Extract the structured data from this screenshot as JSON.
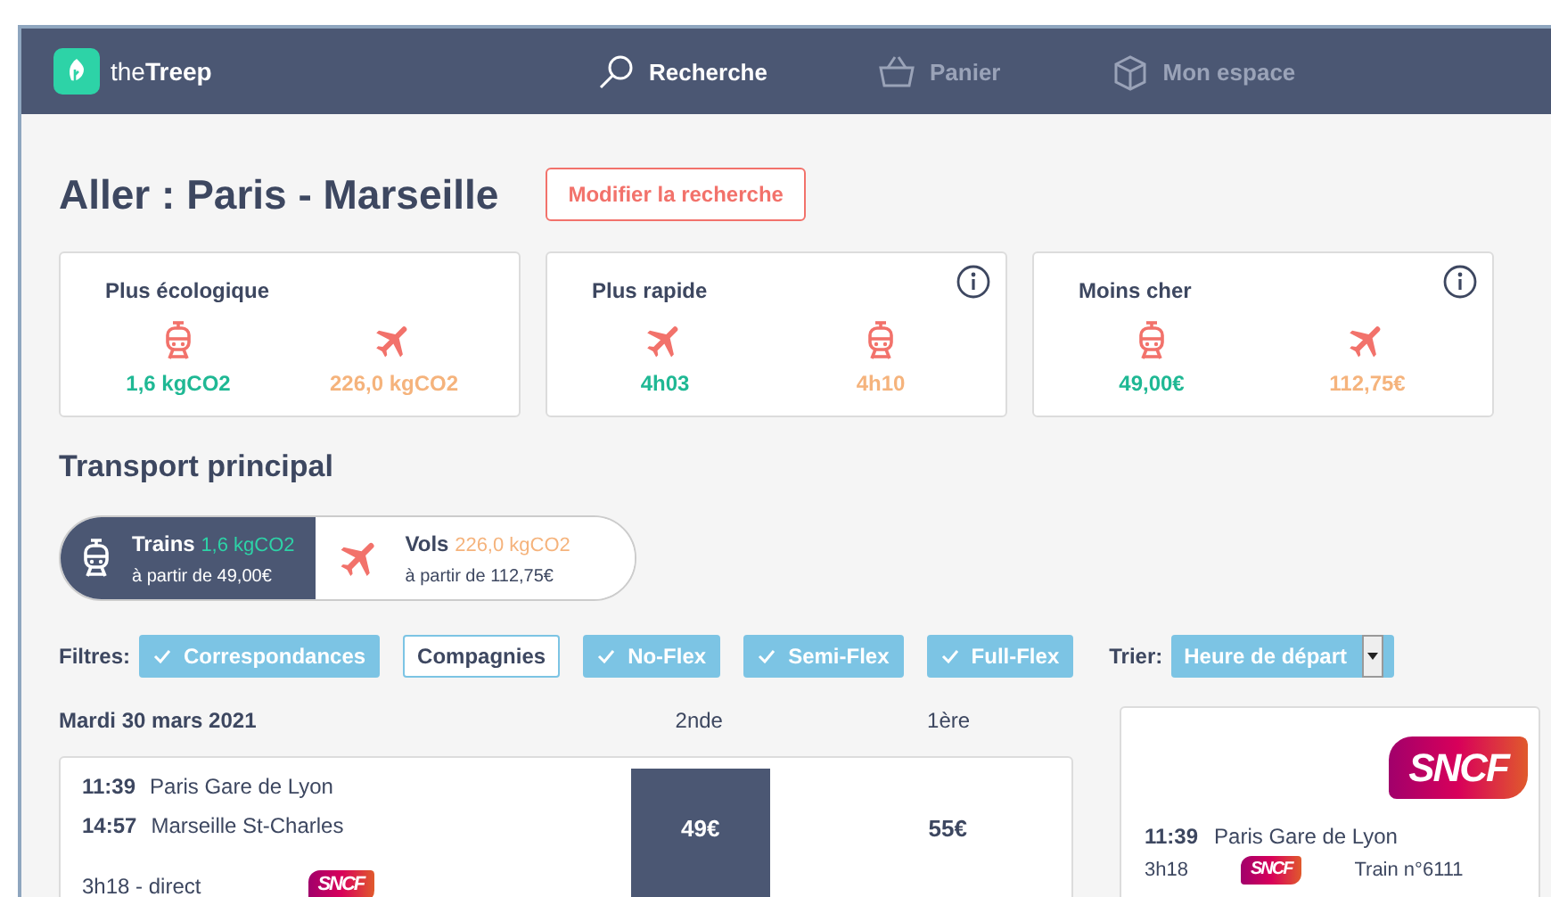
{
  "nav": {
    "logo": {
      "prefix": "the",
      "name": "Treep"
    },
    "items": [
      {
        "kind": "search",
        "label": "Recherche",
        "selected": true
      },
      {
        "kind": "basket",
        "label": "Panier",
        "selected": false
      },
      {
        "kind": "box",
        "label": "Mon espace",
        "selected": false
      }
    ]
  },
  "title": "Aller : Paris - Marseille",
  "modify_button": "Modifier la recherche",
  "summary_cards": [
    {
      "title": "Plus écologique",
      "info": false,
      "options": [
        {
          "kind": "train",
          "value": "1,6 kgCO2",
          "best": true
        },
        {
          "kind": "plane",
          "value": "226,0 kgCO2",
          "best": false
        }
      ]
    },
    {
      "title": "Plus rapide",
      "info": true,
      "options": [
        {
          "kind": "plane",
          "value": "4h03",
          "best": true
        },
        {
          "kind": "train",
          "value": "4h10",
          "best": false
        }
      ]
    },
    {
      "title": "Moins cher",
      "info": true,
      "options": [
        {
          "kind": "train",
          "value": "49,00€",
          "best": true
        },
        {
          "kind": "plane",
          "value": "112,75€",
          "best": false
        }
      ]
    }
  ],
  "section_title": "Transport principal",
  "mode_tabs": [
    {
      "kind": "train",
      "label": "Trains",
      "co2": "1,6 kgCO2",
      "best": true,
      "price": "à partir de 49,00€",
      "selected": true
    },
    {
      "kind": "plane",
      "label": "Vols",
      "co2": "226,0 kgCO2",
      "best": false,
      "price": "à partir de 112,75€",
      "selected": false
    }
  ],
  "filters": {
    "label": "Filtres:",
    "items": [
      {
        "label": "Correspondances",
        "checked": true
      },
      {
        "label": "Compagnies",
        "checked": false
      },
      {
        "label": "No-Flex",
        "checked": true
      },
      {
        "label": "Semi-Flex",
        "checked": true
      },
      {
        "label": "Full-Flex",
        "checked": true
      }
    ],
    "sort_label": "Trier:",
    "sort_value": "Heure de départ"
  },
  "results": {
    "date": "Mardi 30 mars 2021",
    "columns": [
      "2nde",
      "1ère"
    ],
    "rows": [
      {
        "dep_time": "11:39",
        "dep_station": "Paris Gare de Lyon",
        "arr_time": "14:57",
        "arr_station": "Marseille St-Charles",
        "duration": "3h18 - direct",
        "carrier": "SNCF",
        "prices": [
          {
            "value": "49€",
            "selected": true
          },
          {
            "value": "55€",
            "selected": false
          }
        ]
      }
    ]
  },
  "detail": {
    "carrier": "SNCF",
    "time": "11:39",
    "station": "Paris Gare de Lyon",
    "duration": "3h18",
    "carrier_small": "SNCF",
    "train": "Train n°6111"
  }
}
